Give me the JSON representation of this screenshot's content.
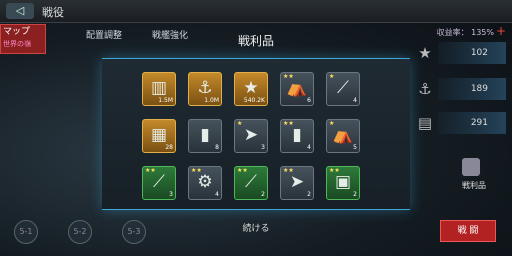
{
  "header": {
    "back_icon": "back-arrow-icon",
    "title": "戦役"
  },
  "tabs": {
    "map_label": "マップ",
    "map_sub": "世界の嶺",
    "formation": "配置調整",
    "strengthen": "戦艦強化"
  },
  "income": {
    "label": "収益率：",
    "value": "135%",
    "plus": "+"
  },
  "resources": [
    {
      "icon": "star-icon",
      "value": "102"
    },
    {
      "icon": "anchor-icon",
      "value": "189"
    },
    {
      "icon": "document-icon",
      "value": "291"
    }
  ],
  "side": {
    "label": "戦利品"
  },
  "nodes": [
    "5-1",
    "5-2",
    "5-3"
  ],
  "start_button": "戦 闘",
  "modal": {
    "title": "戦利品",
    "continue": "続ける"
  },
  "items": [
    {
      "icon": "money-stack-icon",
      "style": "gold",
      "stars": "",
      "qty": "1.5M"
    },
    {
      "icon": "anchor-icon",
      "style": "gold",
      "stars": "",
      "qty": "1.0M"
    },
    {
      "icon": "star-icon",
      "style": "gold",
      "stars": "",
      "qty": "540.2K"
    },
    {
      "icon": "tent-icon",
      "style": "gray",
      "stars": "★★",
      "qty": "6"
    },
    {
      "icon": "gun-barrel-icon",
      "style": "gray",
      "stars": "★",
      "qty": "4"
    },
    {
      "icon": "blueprint-icon",
      "style": "gold",
      "stars": "",
      "qty": "28"
    },
    {
      "icon": "armor-plate-icon",
      "style": "gray",
      "stars": "",
      "qty": "8"
    },
    {
      "icon": "torpedo-icon",
      "style": "gray",
      "stars": "★",
      "qty": "3"
    },
    {
      "icon": "armor-plate-icon",
      "style": "gray",
      "stars": "★★",
      "qty": "4"
    },
    {
      "icon": "tent-icon",
      "style": "gray",
      "stars": "★",
      "qty": "5"
    },
    {
      "icon": "gun-barrel-icon",
      "style": "green",
      "stars": "★★",
      "qty": "3"
    },
    {
      "icon": "engine-icon",
      "style": "gray",
      "stars": "★★",
      "qty": "4"
    },
    {
      "icon": "gun-barrel-icon",
      "style": "green",
      "stars": "★★",
      "qty": "2"
    },
    {
      "icon": "torpedo-icon",
      "style": "gray",
      "stars": "★★",
      "qty": "2"
    },
    {
      "icon": "radar-panel-icon",
      "style": "green",
      "stars": "★★",
      "qty": "2"
    }
  ]
}
